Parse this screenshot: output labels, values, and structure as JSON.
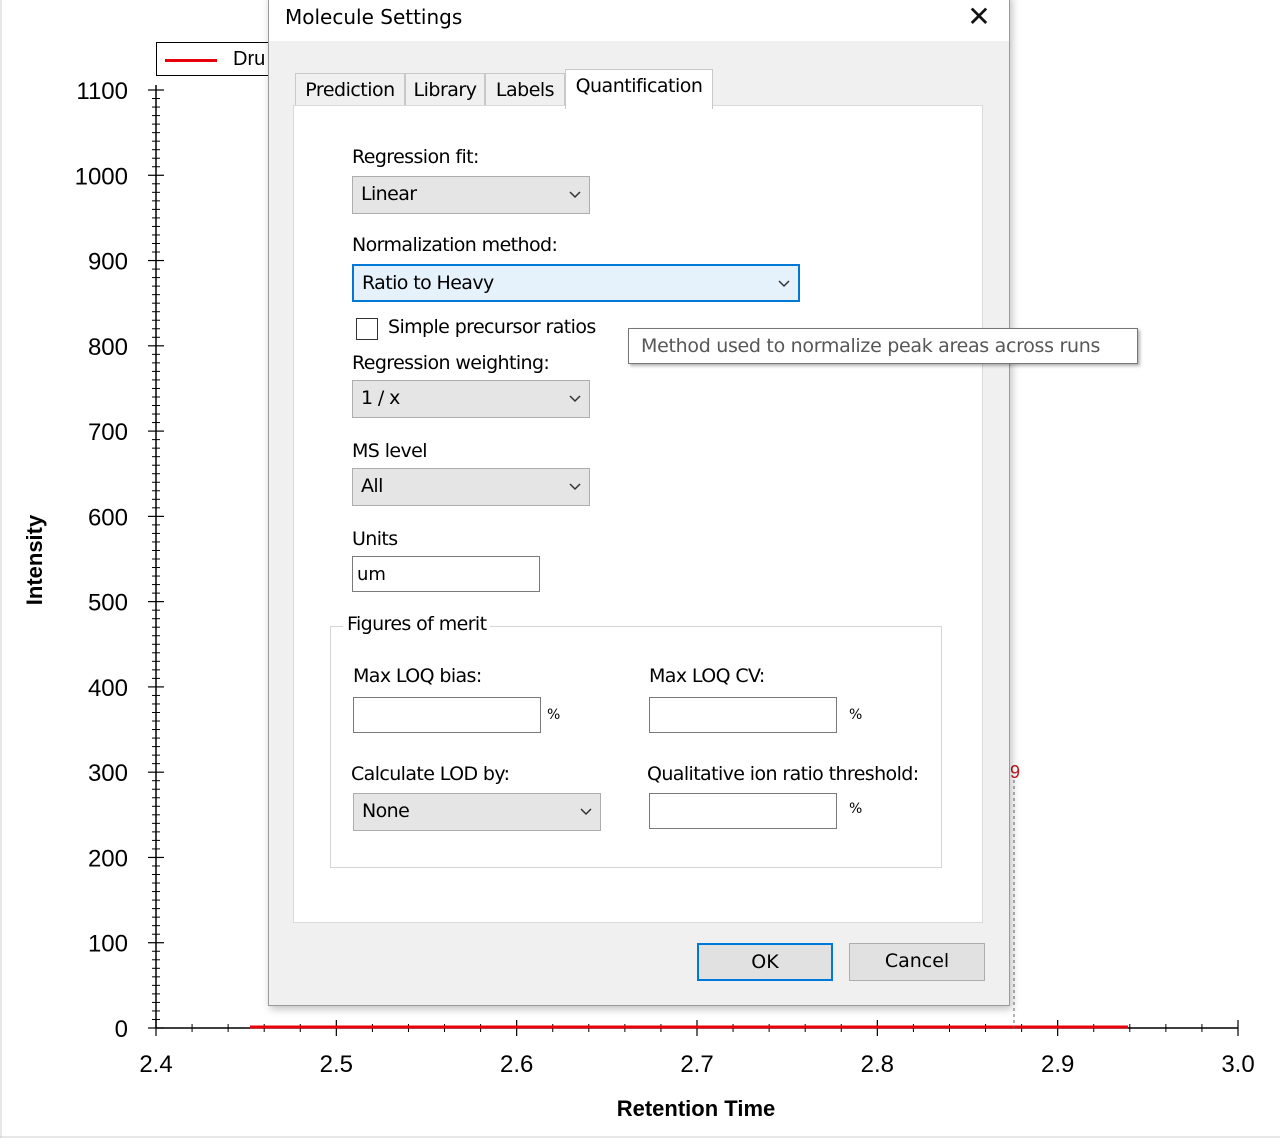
{
  "background_chart": {
    "ylabel": "Intensity",
    "xlabel": "Retention Time",
    "legend_text": "Dru",
    "series_color": "#e8000b",
    "y_ticks": [
      "1100",
      "1000",
      "900",
      "800",
      "700",
      "600",
      "500",
      "400",
      "300",
      "200",
      "100",
      "0"
    ],
    "x_ticks": [
      "2.4",
      "2.5",
      "2.6",
      "2.7",
      "2.8",
      "2.9",
      "3.0"
    ],
    "peak_label": "9"
  },
  "dialog": {
    "title": "Molecule Settings",
    "close_glyph": "✕",
    "tabs": [
      "Prediction",
      "Library",
      "Labels",
      "Quantification"
    ],
    "active_tab": "Quantification",
    "regression_fit": {
      "label": "Regression fit:",
      "value": "Linear"
    },
    "normalization": {
      "label": "Normalization method:",
      "value": "Ratio to Heavy"
    },
    "simple_ratios": {
      "label": "Simple precursor ratios",
      "checked": false
    },
    "regression_weighting": {
      "label": "Regression weighting:",
      "value": "1 / x"
    },
    "ms_level": {
      "label": "MS level",
      "value": "All"
    },
    "units": {
      "label": "Units",
      "value": "um"
    },
    "figures_of_merit": {
      "title": "Figures of merit",
      "max_loq_bias": {
        "label": "Max LOQ bias:",
        "value": "",
        "unit": "%"
      },
      "max_loq_cv": {
        "label": "Max LOQ CV:",
        "value": "",
        "unit": "%"
      },
      "calc_lod": {
        "label": "Calculate LOD by:",
        "value": "None"
      },
      "ion_ratio": {
        "label": "Qualitative ion ratio threshold:",
        "value": "",
        "unit": "%"
      }
    },
    "ok_label": "OK",
    "cancel_label": "Cancel"
  },
  "tooltip": "Method used to normalize peak areas across runs",
  "icons": {
    "chevron": "chevron-down-icon",
    "close": "close-icon",
    "checkbox": "checkbox-icon"
  }
}
